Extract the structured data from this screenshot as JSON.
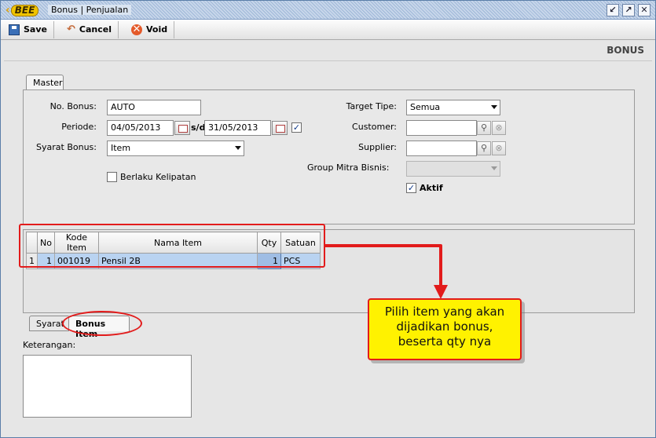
{
  "window": {
    "logo_text": "BEE",
    "title": "Bonus | Penjualan"
  },
  "toolbar": {
    "save_label": "Save",
    "cancel_label": "Cancel",
    "void_label": "Void"
  },
  "page_heading": "BONUS",
  "tabs_top": {
    "master": "Master"
  },
  "form": {
    "no_bonus_label": "No. Bonus:",
    "no_bonus_value": "AUTO",
    "periode_label": "Periode:",
    "periode_from": "04/05/2013",
    "periode_sep": "s/d",
    "periode_to": "31/05/2013",
    "syarat_bonus_label": "Syarat Bonus:",
    "syarat_bonus_value": "Item",
    "berlaku_kelipatan_label": "Berlaku Kelipatan",
    "berlaku_kelipatan_checked": false,
    "target_tipe_label": "Target Tipe:",
    "target_tipe_value": "Semua",
    "customer_label": "Customer:",
    "customer_value": "",
    "supplier_label": "Supplier:",
    "supplier_value": "",
    "group_mitra_label": "Group Mitra Bisnis:",
    "group_mitra_value": "",
    "aktif_label": "Aktif",
    "aktif_checked": true
  },
  "grid": {
    "headers": [
      "No",
      "Kode Item",
      "Nama Item",
      "Qty",
      "Satuan"
    ],
    "rows": [
      {
        "rownum": "1",
        "no": "1",
        "kode": "001019",
        "nama": "Pensil 2B",
        "qty": "1",
        "satuan": "PCS"
      }
    ]
  },
  "tabs_bottom": {
    "syarat": "Syarat",
    "bonus_item": "Bonus Item"
  },
  "keterangan_label": "Keterangan:",
  "keterangan_value": "",
  "callout": {
    "line1": "Pilih item yang akan",
    "line2": "dijadikan bonus,",
    "line3": "beserta qty nya"
  },
  "colors": {
    "accent_red": "#e21b1b",
    "callout_yellow": "#fff200",
    "selected_row": "#b9d3f1"
  },
  "icons": {
    "save": "floppy-icon",
    "cancel": "undo-arrow-icon",
    "void": "stop-circle-icon",
    "calendar": "calendar-icon",
    "search": "magnifier-icon",
    "clear": "clear-icon"
  }
}
